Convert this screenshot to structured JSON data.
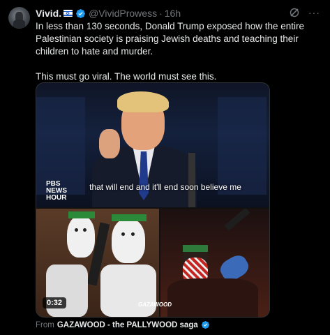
{
  "tweet": {
    "author_name": "Vivid.",
    "author_handle": "@VividProwess",
    "separator": "·",
    "timestamp": "16h",
    "more_label": "···",
    "text_paragraphs": [
      "In less than 130 seconds, Donald Trump exposed how the entire Palestinian society is praising Jewish deaths and teaching their children to hate and murder.",
      "This must go viral. The world must see this."
    ]
  },
  "media": {
    "logo_line1": "PBS",
    "logo_line2": "NEWS",
    "logo_line3": "HOUR",
    "caption": "that will end and it'll end soon believe me",
    "duration": "0:32",
    "watermark": "GAZAWOOD"
  },
  "source": {
    "prefix": "From",
    "name": "GAZAWOOD - the PALLYWOOD saga"
  },
  "colors": {
    "background": "#000000",
    "text": "#e7e9ea",
    "muted": "#71767b",
    "verified": "#1d9bf0"
  }
}
